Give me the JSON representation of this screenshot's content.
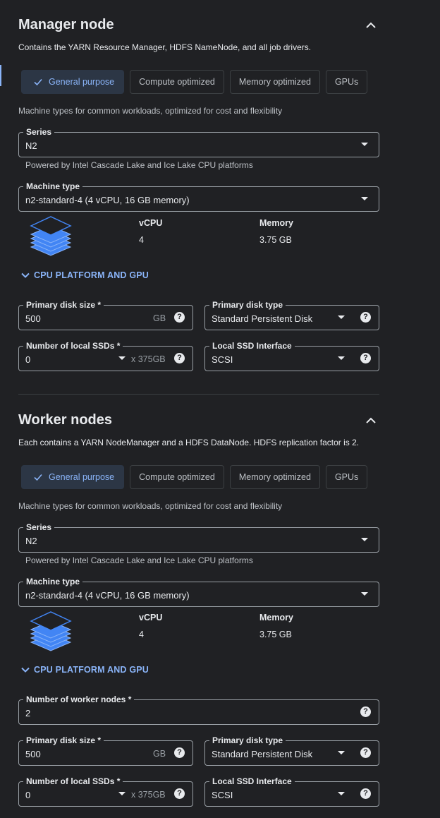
{
  "manager": {
    "title": "Manager node",
    "description": "Contains the YARN Resource Manager, HDFS NameNode, and all job drivers.",
    "tabs": [
      "General purpose",
      "Compute optimized",
      "Memory optimized",
      "GPUs"
    ],
    "tab_help": "Machine types for common workloads, optimized for cost and flexibility",
    "series": {
      "label": "Series",
      "value": "N2",
      "help": "Powered by Intel Cascade Lake and Ice Lake CPU platforms"
    },
    "machine_type": {
      "label": "Machine type",
      "value": "n2-standard-4 (4 vCPU, 16 GB memory)"
    },
    "specs": {
      "vcpu_label": "vCPU",
      "vcpu_value": "4",
      "memory_label": "Memory",
      "memory_value": "3.75 GB"
    },
    "cpu_link": "CPU PLATFORM AND GPU",
    "disk_size": {
      "label": "Primary disk size *",
      "value": "500",
      "unit": "GB"
    },
    "disk_type": {
      "label": "Primary disk type",
      "value": "Standard Persistent Disk"
    },
    "local_ssds": {
      "label": "Number of local SSDs *",
      "value": "0",
      "unit": "x 375GB"
    },
    "ssd_interface": {
      "label": "Local SSD Interface",
      "value": "SCSI"
    }
  },
  "worker": {
    "title": "Worker nodes",
    "description": "Each contains a YARN NodeManager and a HDFS DataNode. HDFS replication factor is 2.",
    "tabs": [
      "General purpose",
      "Compute optimized",
      "Memory optimized",
      "GPUs"
    ],
    "tab_help": "Machine types for common workloads, optimized for cost and flexibility",
    "series": {
      "label": "Series",
      "value": "N2",
      "help": "Powered by Intel Cascade Lake and Ice Lake CPU platforms"
    },
    "machine_type": {
      "label": "Machine type",
      "value": "n2-standard-4 (4 vCPU, 16 GB memory)"
    },
    "specs": {
      "vcpu_label": "vCPU",
      "vcpu_value": "4",
      "memory_label": "Memory",
      "memory_value": "3.75 GB"
    },
    "cpu_link": "CPU PLATFORM AND GPU",
    "worker_count": {
      "label": "Number of worker nodes *",
      "value": "2"
    },
    "disk_size": {
      "label": "Primary disk size *",
      "value": "500",
      "unit": "GB"
    },
    "disk_type": {
      "label": "Primary disk type",
      "value": "Standard Persistent Disk"
    },
    "local_ssds": {
      "label": "Number of local SSDs *",
      "value": "0",
      "unit": "x 375GB"
    },
    "ssd_interface": {
      "label": "Local SSD Interface",
      "value": "SCSI"
    }
  },
  "icons": {
    "help": "?"
  },
  "colors": {
    "accent": "#8ab4f8",
    "background": "#202124",
    "selected_chip": "#2c3645"
  }
}
